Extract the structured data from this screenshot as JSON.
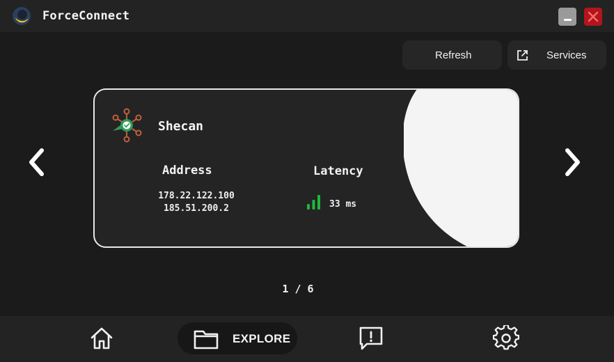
{
  "window": {
    "title": "ForceConnect"
  },
  "toolbar": {
    "refresh_label": "Refresh",
    "services_label": "Services",
    "services_icon": "external-link-icon"
  },
  "card": {
    "service_name": "Shecan",
    "service_icon": "network-hub-check-icon",
    "address_heading": "Address",
    "addresses": [
      "178.22.122.100",
      "185.51.200.2"
    ],
    "latency_heading": "Latency",
    "latency_value": "33 ms",
    "latency_icon": "signal-bars-icon",
    "signal_color": "#1fb83a"
  },
  "pager": {
    "text": "1 / 6"
  },
  "nav": {
    "items": [
      {
        "id": "home",
        "icon": "home-icon"
      },
      {
        "id": "explore",
        "icon": "folder-icon",
        "label": "EXPLORE",
        "active": true
      },
      {
        "id": "feedback",
        "icon": "feedback-icon"
      },
      {
        "id": "settings",
        "icon": "gear-icon"
      }
    ]
  },
  "colors": {
    "background": "#1b1b1b",
    "bar": "#232323",
    "close": "#b0161c",
    "accent_logo": "#f5c518"
  }
}
